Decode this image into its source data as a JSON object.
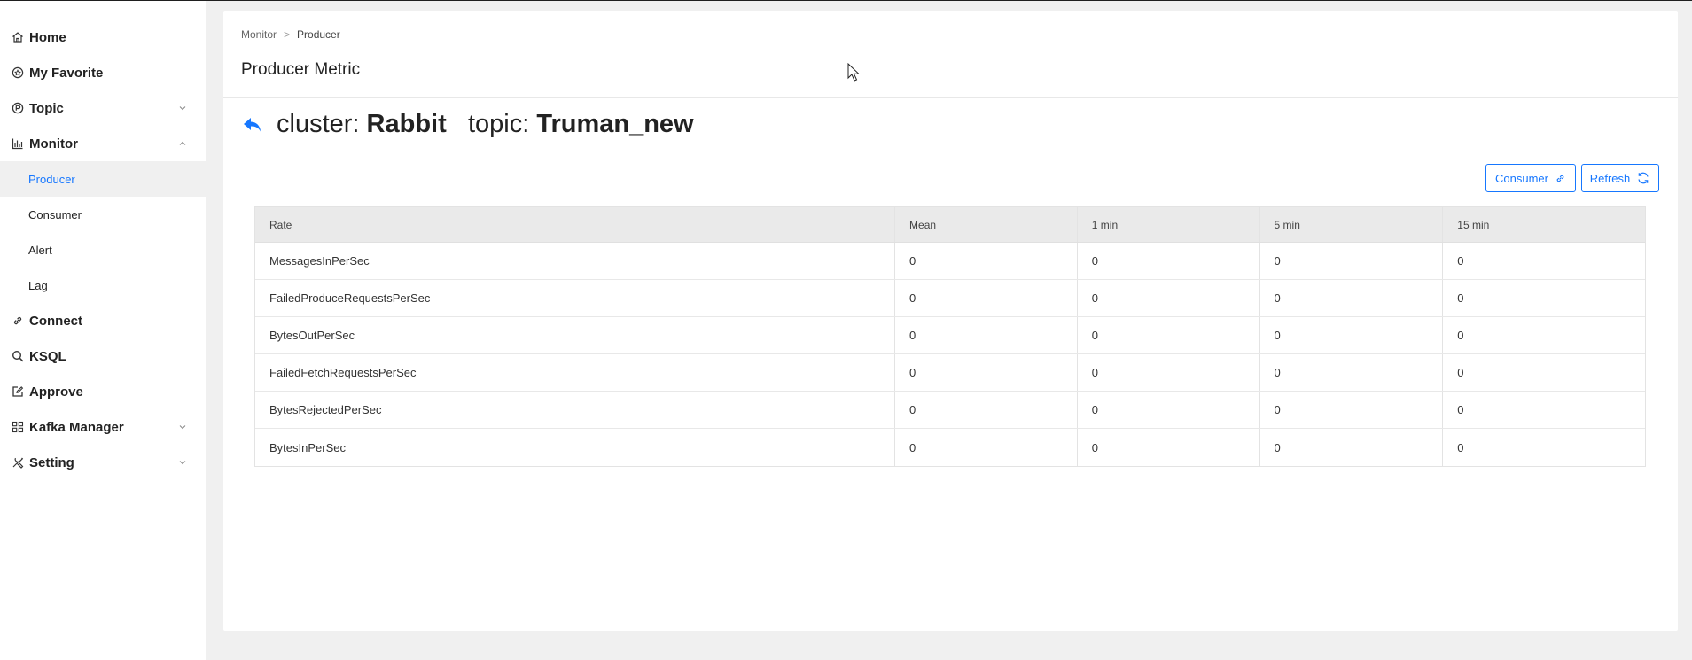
{
  "sidebar": {
    "items": [
      {
        "label": "Home",
        "icon": "home-icon"
      },
      {
        "label": "My Favorite",
        "icon": "favorite-icon"
      },
      {
        "label": "Topic",
        "icon": "topic-icon",
        "expandable": true,
        "expanded": false
      },
      {
        "label": "Monitor",
        "icon": "monitor-icon",
        "expandable": true,
        "expanded": true,
        "children": [
          {
            "label": "Producer",
            "active": true
          },
          {
            "label": "Consumer"
          },
          {
            "label": "Alert"
          },
          {
            "label": "Lag"
          }
        ]
      },
      {
        "label": "Connect",
        "icon": "link-icon"
      },
      {
        "label": "KSQL",
        "icon": "search-icon"
      },
      {
        "label": "Approve",
        "icon": "edit-icon"
      },
      {
        "label": "Kafka Manager",
        "icon": "grid-icon",
        "expandable": true,
        "expanded": false
      },
      {
        "label": "Setting",
        "icon": "tools-icon",
        "expandable": true,
        "expanded": false
      }
    ]
  },
  "breadcrumb": {
    "items": [
      "Monitor",
      "Producer"
    ],
    "separator": ">"
  },
  "page": {
    "title": "Producer Metric"
  },
  "info": {
    "cluster_label": "cluster:",
    "cluster_value": "Rabbit",
    "topic_label": "topic:",
    "topic_value": "Truman_new"
  },
  "actions": {
    "consumer_label": "Consumer",
    "refresh_label": "Refresh"
  },
  "table": {
    "columns": [
      "Rate",
      "Mean",
      "1 min",
      "5 min",
      "15 min"
    ],
    "rows": [
      [
        "MessagesInPerSec",
        "0",
        "0",
        "0",
        "0"
      ],
      [
        "FailedProduceRequestsPerSec",
        "0",
        "0",
        "0",
        "0"
      ],
      [
        "BytesOutPerSec",
        "0",
        "0",
        "0",
        "0"
      ],
      [
        "FailedFetchRequestsPerSec",
        "0",
        "0",
        "0",
        "0"
      ],
      [
        "BytesRejectedPerSec",
        "0",
        "0",
        "0",
        "0"
      ],
      [
        "BytesInPerSec",
        "0",
        "0",
        "0",
        "0"
      ]
    ]
  },
  "colors": {
    "accent": "#1677ff",
    "background": "#f0f0f0",
    "header_row": "#eaeaea"
  }
}
